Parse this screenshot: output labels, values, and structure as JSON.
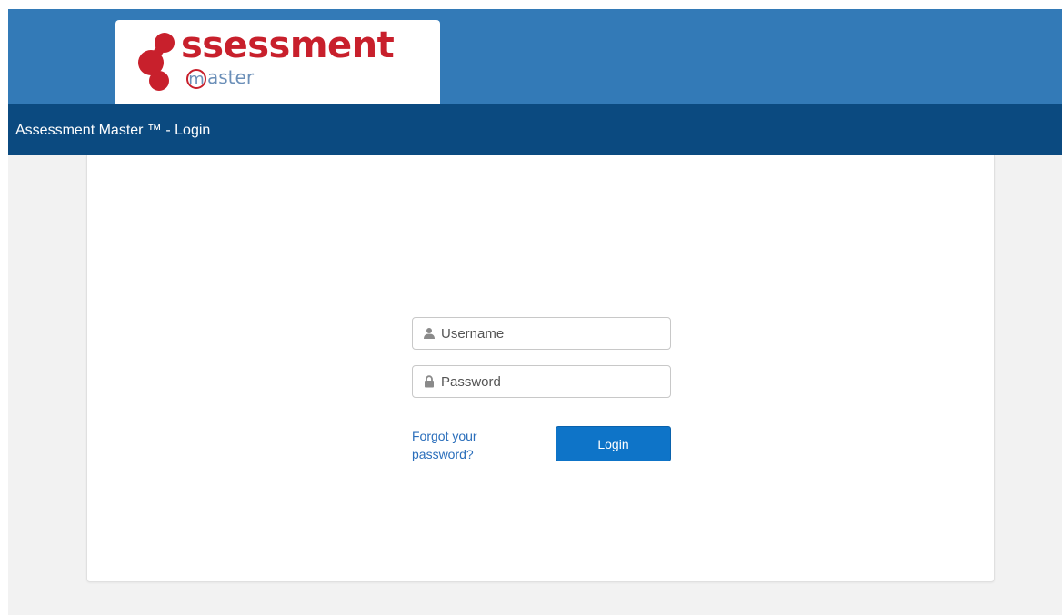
{
  "header": {
    "logo": {
      "word": "ssessment",
      "sub_initial": "m",
      "sub_rest": "aster",
      "brand_red": "#c8202c",
      "brand_blue": "#6b8fb8"
    },
    "banner_color": "#337ab7"
  },
  "title_bar": {
    "text": "Assessment Master ™ - Login",
    "color": "#0b4a80"
  },
  "login": {
    "username": {
      "icon": "user-icon",
      "placeholder": "Username",
      "value": ""
    },
    "password": {
      "icon": "lock-icon",
      "placeholder": "Password",
      "value": ""
    },
    "forgot_label": "Forgot your password?",
    "login_label": "Login",
    "button_color": "#0e74c8"
  }
}
